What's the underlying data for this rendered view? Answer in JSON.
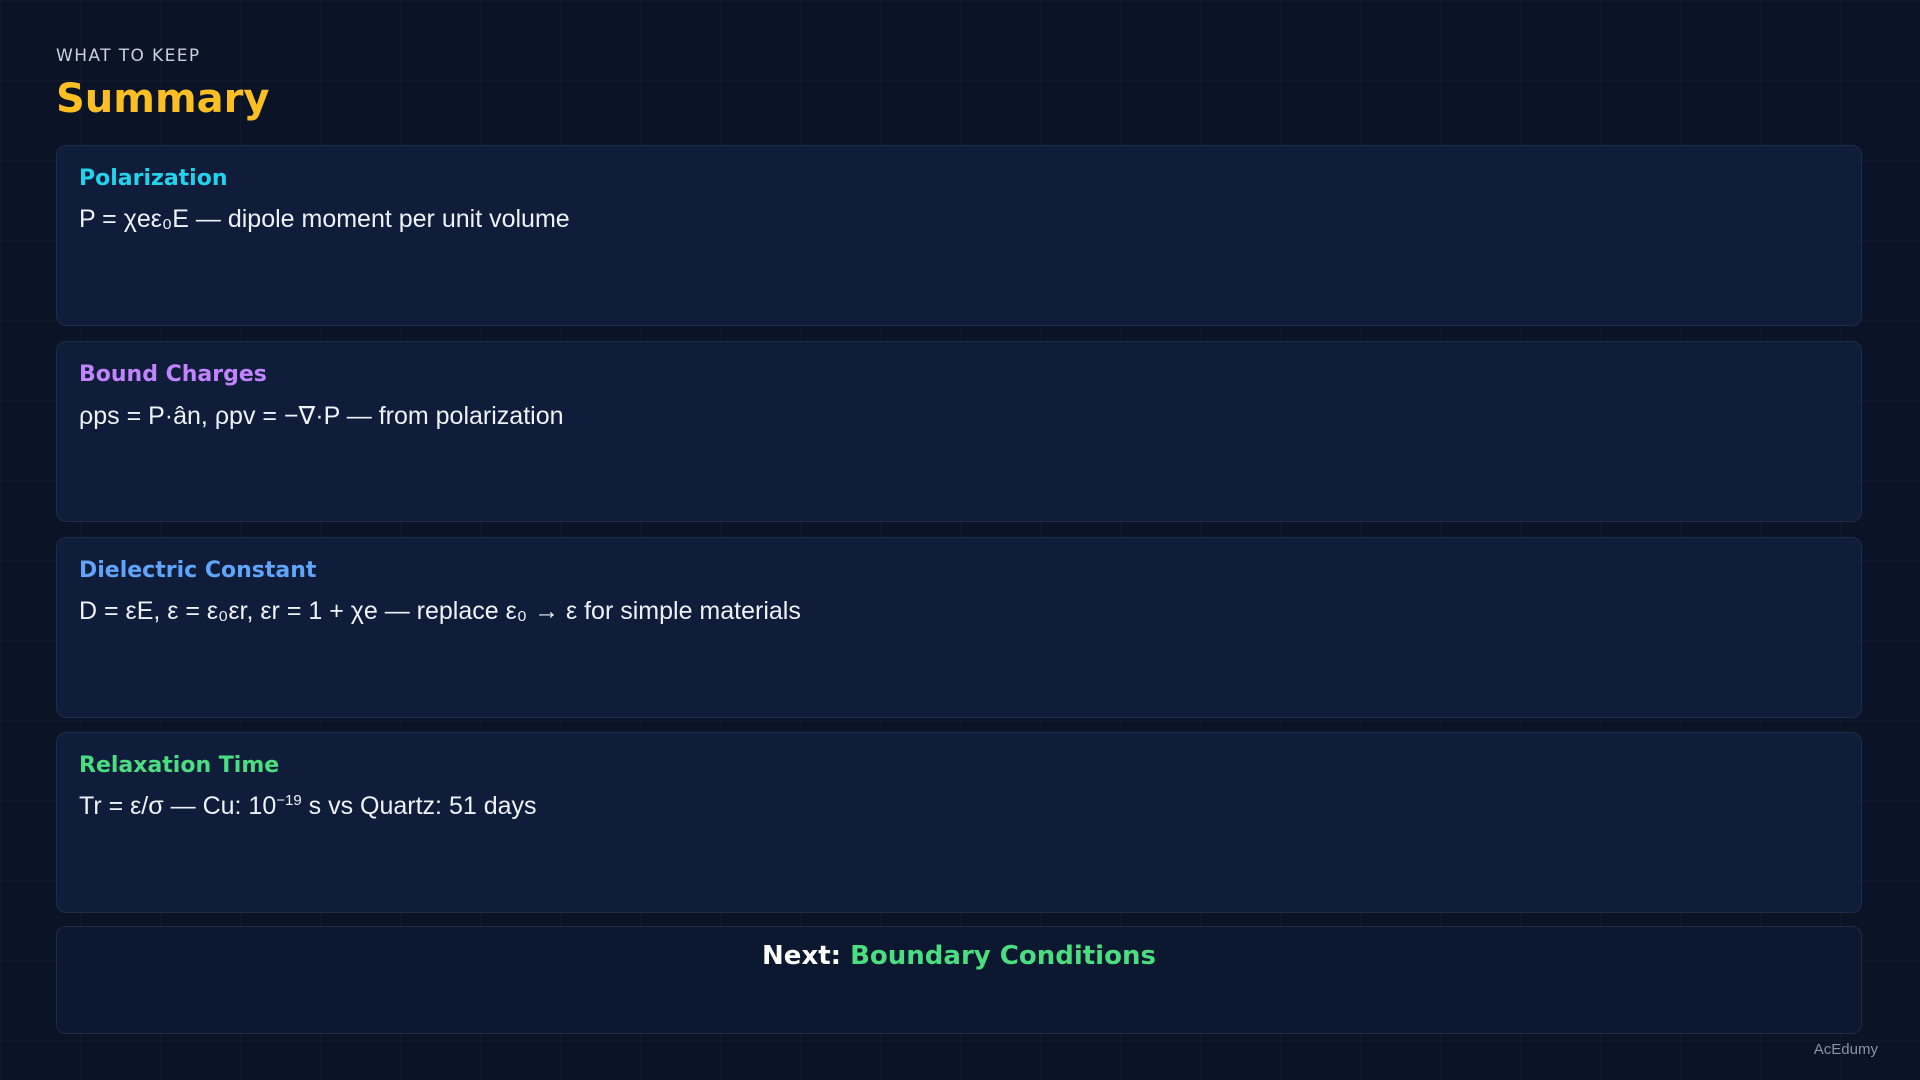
{
  "header": {
    "eyebrow": "WHAT TO KEEP",
    "title": "Summary"
  },
  "cards": [
    {
      "label": "Polarization",
      "body": "P = χeε₀E — dipole moment per unit volume",
      "color": "#22d3ee"
    },
    {
      "label": "Bound Charges",
      "body": "ρps = P·ân, ρpv = −∇·P — from polarization",
      "color": "#c084fc"
    },
    {
      "label": "Dielectric Constant",
      "body": "D = εE, ε = ε₀εr, εr = 1 + χe — replace ε₀ → ε for simple materials",
      "color": "#60a5fa"
    },
    {
      "label": "Relaxation Time",
      "body_prefix": "Tr = ε/σ — Cu: 10",
      "body_exponent": "−19",
      "body_suffix": " s vs Quartz: 51 days",
      "color": "#4ade80"
    }
  ],
  "next": {
    "prefix": "Next:",
    "topic": "Boundary Conditions",
    "topic_color": "#4ade80"
  },
  "watermark": "AcEdumy",
  "colors": {
    "background": "#0b1326",
    "card": "#0f1d3a",
    "title": "#fbbf24"
  }
}
